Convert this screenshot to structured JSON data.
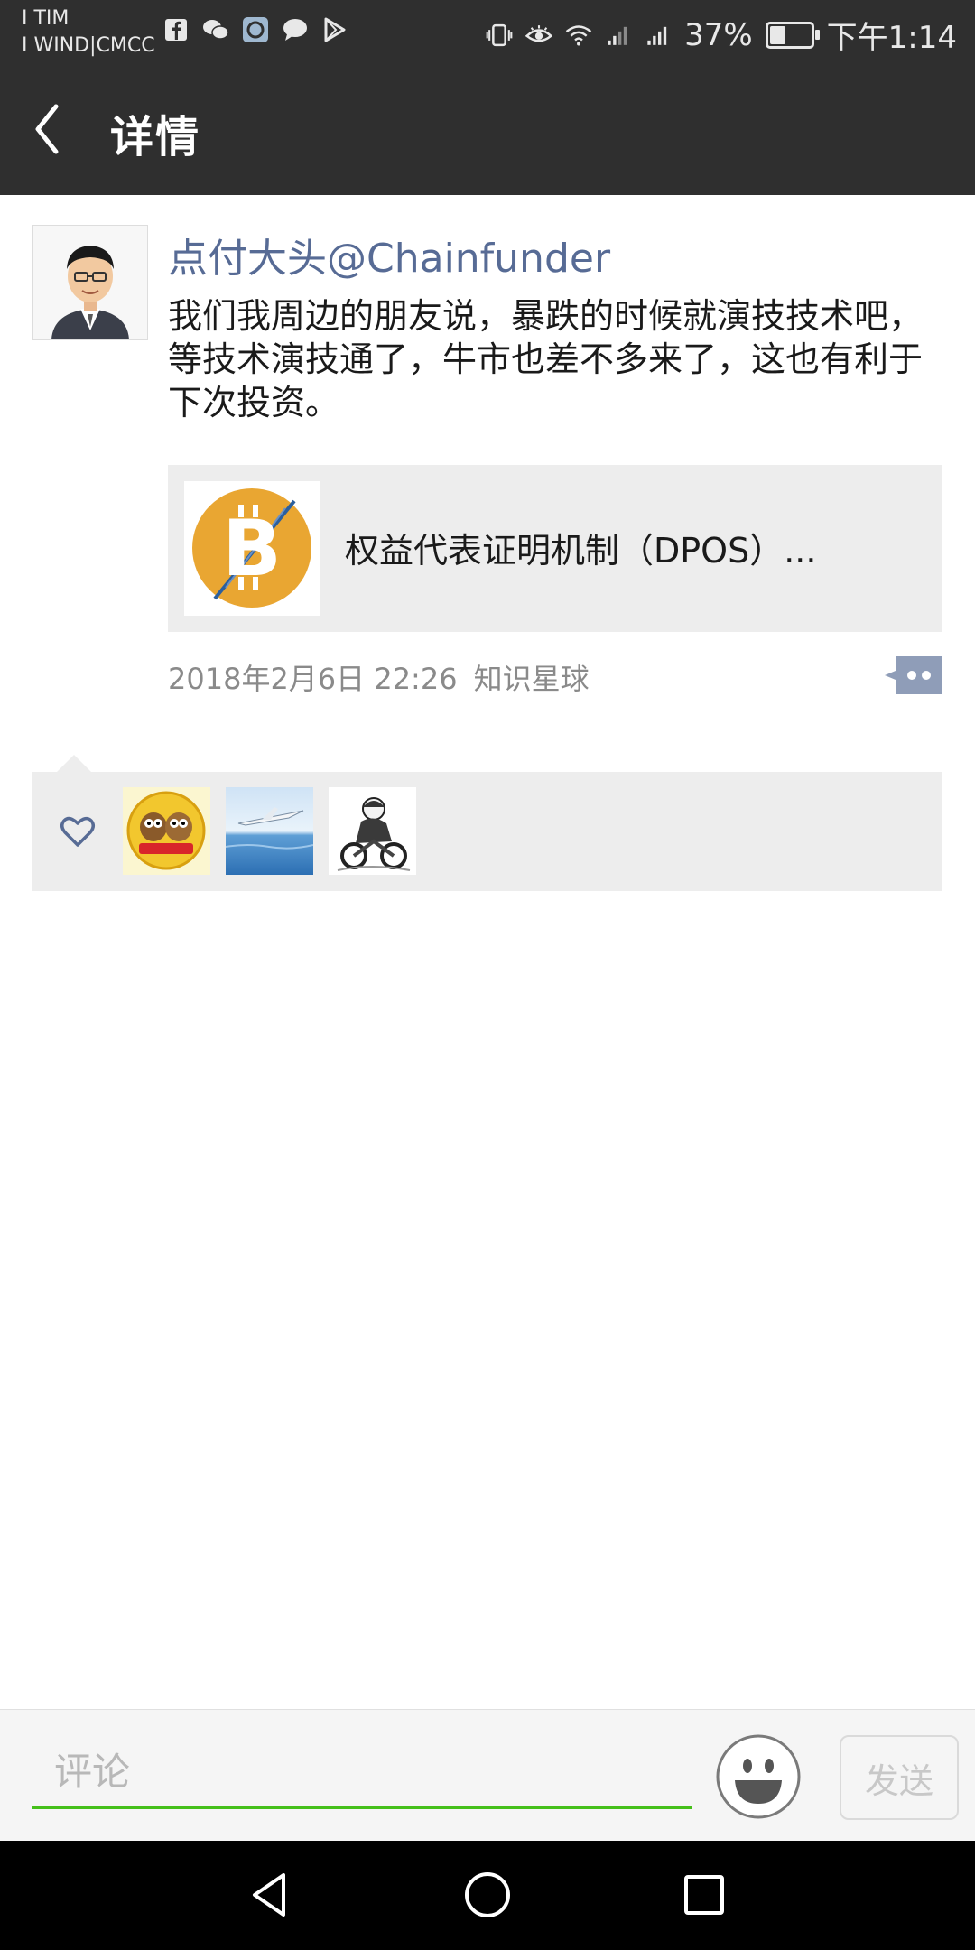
{
  "status_bar": {
    "carrier_line1": "I TIM",
    "carrier_line2": "I WIND|CMCC",
    "battery_percent": "37%",
    "battery_level": 0.37,
    "time": "下午1:14"
  },
  "header": {
    "title": "详情"
  },
  "post": {
    "user_name": "点付大头@Chainfunder",
    "text": "我们我周边的朋友说，暴跌的时候就演技技术吧，等技术演技通了，牛市也差不多来了，这也有利于下次投资。",
    "link_title": "权益代表证明机制（DPOS）...",
    "time": "2018年2月6日 22:26",
    "source": "知识星球"
  },
  "likes": {
    "avatars": [
      "owl-couple-avatar",
      "airplane-sea-avatar",
      "motorcycle-rider-avatar"
    ]
  },
  "comment": {
    "placeholder": "评论",
    "send_label": "发送"
  },
  "colors": {
    "name": "#576b95",
    "accent_green": "#45c01a",
    "dark_bar": "#2f2f2f"
  }
}
